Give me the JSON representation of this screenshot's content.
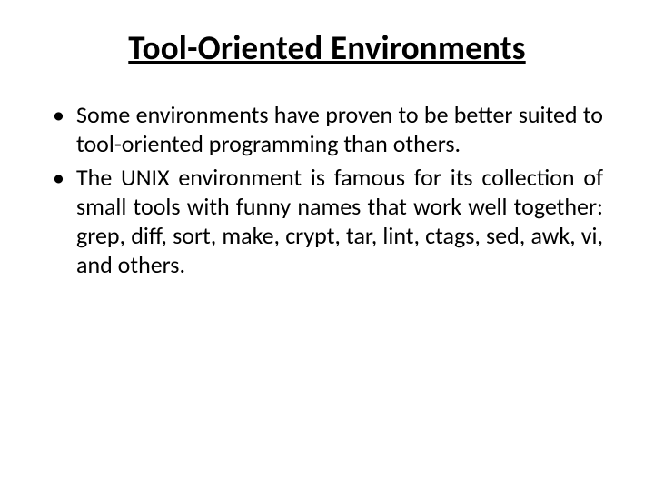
{
  "slide": {
    "title": "Tool-Oriented Environments",
    "bullets": [
      "Some environments have proven to be better suited to tool-oriented programming than others.",
      "The UNIX environment is famous for its collection of small tools with funny names that work well together: grep, diff, sort, make, crypt, tar, lint, ctags, sed, awk, vi, and others."
    ]
  }
}
